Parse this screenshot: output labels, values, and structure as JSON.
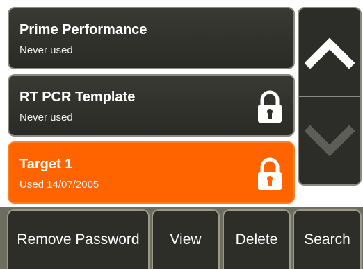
{
  "templates": [
    {
      "title": "Prime Performance",
      "subtitle": "Never used",
      "locked": false,
      "selected": false
    },
    {
      "title": "RT PCR Template",
      "subtitle": "Never used",
      "locked": true,
      "selected": false
    },
    {
      "title": "Target 1",
      "subtitle": "Used 14/07/2005",
      "locked": true,
      "selected": true
    }
  ],
  "scroll": {
    "up_icon": "chevron-up-icon",
    "down_icon": "chevron-down-icon",
    "down_enabled": false
  },
  "toolbar": {
    "remove_password_label": "Remove Password",
    "view_label": "View",
    "delete_label": "Delete",
    "search_label": "Search"
  },
  "colors": {
    "selected": "#ff6400",
    "item_background": "#2e2e28",
    "chevron_active": "#ffffff",
    "chevron_disabled": "#5e5e58"
  }
}
